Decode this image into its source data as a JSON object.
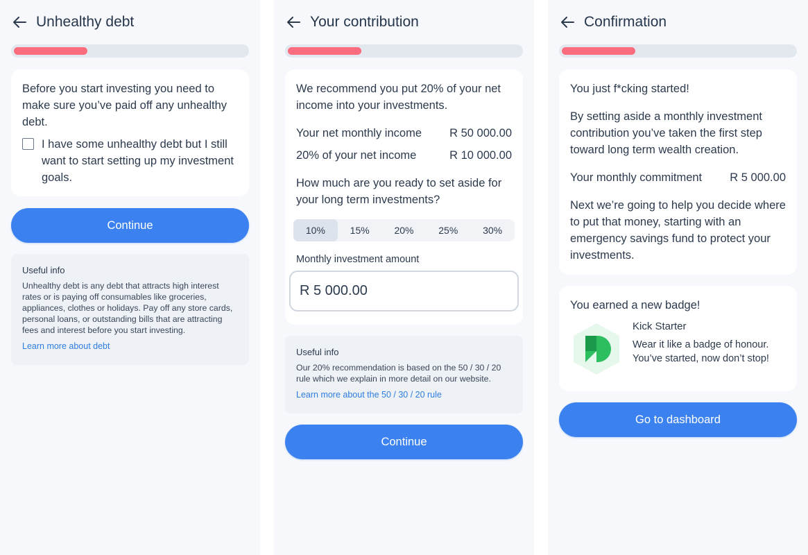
{
  "screens": [
    {
      "title": "Unhealthy debt",
      "progress": 0.31,
      "card": {
        "text": "Before you start investing you need to make sure you’ve paid off any unhealthy debt.",
        "checkbox_label": "I have some unhealthy debt but I still want to start setting up my investment goals.",
        "checked": false
      },
      "button": "Continue",
      "info": {
        "heading": "Useful info",
        "body": "Unhealthy debt is any debt that attracts high interest rates or is paying off consumables like groceries, appliances, clothes or holidays. Pay off any store cards, personal loans, or outstanding bills that are attracting fees and interest before you start investing.",
        "link": "Learn more about debt"
      }
    },
    {
      "title": "Your contribution",
      "progress": 0.31,
      "card": {
        "text": "We recommend you put 20% of your net income into your investments.",
        "rows": [
          {
            "label": "Your net monthly income",
            "value": "R 50 000.00"
          },
          {
            "label": "20% of your net income",
            "value": "R 10 000.00"
          }
        ],
        "question": "How much are you ready to set aside for your long term investments?",
        "options": [
          "10%",
          "15%",
          "20%",
          "25%",
          "30%"
        ],
        "selected": "10%",
        "amount_label": "Monthly investment amount",
        "amount_value": "R 5 000.00"
      },
      "info": {
        "heading": "Useful info",
        "body": "Our 20% recommendation is based on the 50 / 30 / 20 rule which we explain in more detail on our website.",
        "link": "Learn more about the 50 / 30 / 20 rule"
      },
      "button": "Continue"
    },
    {
      "title": "Confirmation",
      "progress": 0.31,
      "card": {
        "p1": "You just f*cking started!",
        "p2": "By setting aside a monthly investment contribution you’ve taken the first step toward long term wealth creation.",
        "commitment_label": "Your monthly commitment",
        "commitment_value": "R 5 000.00",
        "p3": "Next we’re going to help you decide where to put that money, starting with an emergency savings fund to protect your investments."
      },
      "badge": {
        "heading": "You earned a new badge!",
        "name": "Kick Starter",
        "desc": "Wear it like a badge of honour. You’ve started, now don’t stop!"
      },
      "button": "Go to dashboard"
    }
  ],
  "colors": {
    "accent": "#3b82f0",
    "progress_fill": "#fb6c7f",
    "progress_track": "#e3e8ef",
    "link": "#2f7de1",
    "badge_green": "#2dbf5f"
  }
}
